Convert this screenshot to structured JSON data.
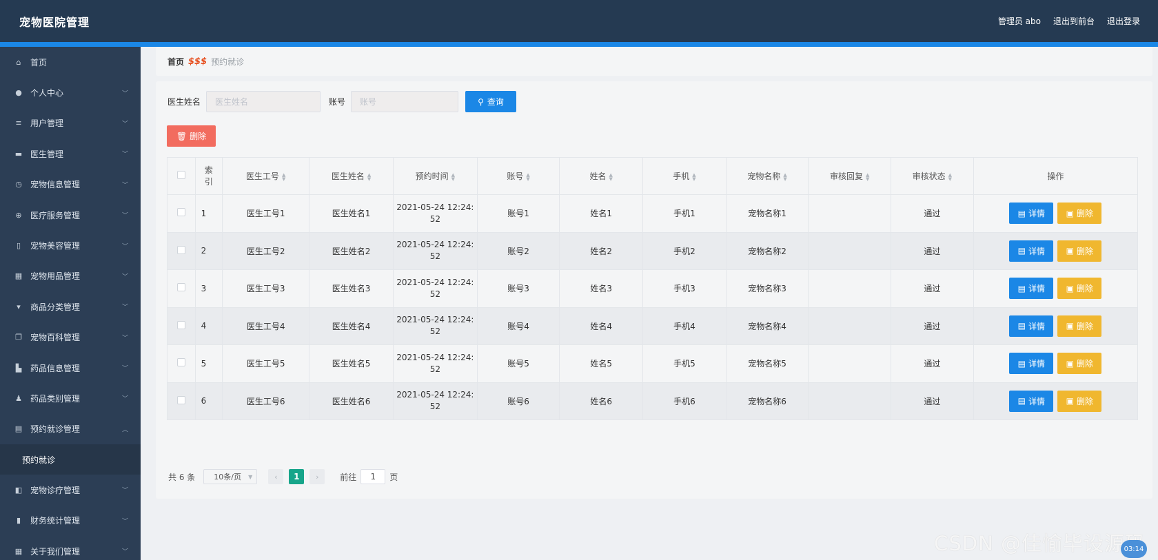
{
  "header": {
    "title": "宠物医院管理",
    "admin_label": "管理员 abo",
    "to_front": "退出到前台",
    "logout": "退出登录"
  },
  "sidebar": {
    "items": [
      {
        "label": "首页",
        "icon": "home-icon",
        "glyph": "⌂",
        "chev": false
      },
      {
        "label": "个人中心",
        "icon": "user-icon",
        "glyph": "●",
        "chev": true
      },
      {
        "label": "用户管理",
        "icon": "list-icon",
        "glyph": "≡",
        "chev": true
      },
      {
        "label": "医生管理",
        "icon": "chat-icon",
        "glyph": "▬",
        "chev": true
      },
      {
        "label": "宠物信息管理",
        "icon": "clock-icon",
        "glyph": "◷",
        "chev": true
      },
      {
        "label": "医疗服务管理",
        "icon": "compass-icon",
        "glyph": "⊕",
        "chev": true
      },
      {
        "label": "宠物美容管理",
        "icon": "mic-icon",
        "glyph": "▯",
        "chev": true
      },
      {
        "label": "宠物用品管理",
        "icon": "grid-icon",
        "glyph": "▦",
        "chev": true
      },
      {
        "label": "商品分类管理",
        "icon": "tag-icon",
        "glyph": "▾",
        "chev": true
      },
      {
        "label": "宠物百科管理",
        "icon": "copy-icon",
        "glyph": "❐",
        "chev": true
      },
      {
        "label": "药品信息管理",
        "icon": "thumb-icon",
        "glyph": "▙",
        "chev": true
      },
      {
        "label": "药品类别管理",
        "icon": "person-icon",
        "glyph": "♟",
        "chev": true
      },
      {
        "label": "预约就诊管理",
        "icon": "folder-icon",
        "glyph": "▤",
        "chev": true,
        "expanded": true
      }
    ],
    "sub_item": "预约就诊",
    "items_after": [
      {
        "label": "宠物诊疗管理",
        "icon": "video-icon",
        "glyph": "◧",
        "chev": true
      },
      {
        "label": "财务统计管理",
        "icon": "bar-chart-icon",
        "glyph": "▮",
        "chev": true
      },
      {
        "label": "关于我们管理",
        "icon": "apps-icon",
        "glyph": "▦",
        "chev": true
      }
    ]
  },
  "breadcrumb": {
    "home": "首页",
    "separator": "$$$",
    "current": "预约就诊"
  },
  "search": {
    "doctor_name_label": "医生姓名",
    "doctor_name_placeholder": "医生姓名",
    "account_label": "账号",
    "account_placeholder": "账号",
    "query_button": "查询"
  },
  "bulk_delete_button": "删除",
  "table": {
    "headers": [
      "索引",
      "医生工号",
      "医生姓名",
      "预约时间",
      "账号",
      "姓名",
      "手机",
      "宠物名称",
      "审核回复",
      "审核状态",
      "操作"
    ],
    "rows": [
      {
        "index": "1",
        "doctor_no": "医生工号1",
        "doctor_name": "医生姓名1",
        "time_a": "2021-05-24 12:24:",
        "time_b": "52",
        "account": "账号1",
        "name": "姓名1",
        "phone": "手机1",
        "pet": "宠物名称1",
        "reply": "",
        "status": "通过"
      },
      {
        "index": "2",
        "doctor_no": "医生工号2",
        "doctor_name": "医生姓名2",
        "time_a": "2021-05-24 12:24:",
        "time_b": "52",
        "account": "账号2",
        "name": "姓名2",
        "phone": "手机2",
        "pet": "宠物名称2",
        "reply": "",
        "status": "通过"
      },
      {
        "index": "3",
        "doctor_no": "医生工号3",
        "doctor_name": "医生姓名3",
        "time_a": "2021-05-24 12:24:",
        "time_b": "52",
        "account": "账号3",
        "name": "姓名3",
        "phone": "手机3",
        "pet": "宠物名称3",
        "reply": "",
        "status": "通过"
      },
      {
        "index": "4",
        "doctor_no": "医生工号4",
        "doctor_name": "医生姓名4",
        "time_a": "2021-05-24 12:24:",
        "time_b": "52",
        "account": "账号4",
        "name": "姓名4",
        "phone": "手机4",
        "pet": "宠物名称4",
        "reply": "",
        "status": "通过"
      },
      {
        "index": "5",
        "doctor_no": "医生工号5",
        "doctor_name": "医生姓名5",
        "time_a": "2021-05-24 12:24:",
        "time_b": "52",
        "account": "账号5",
        "name": "姓名5",
        "phone": "手机5",
        "pet": "宠物名称5",
        "reply": "",
        "status": "通过"
      },
      {
        "index": "6",
        "doctor_no": "医生工号6",
        "doctor_name": "医生姓名6",
        "time_a": "2021-05-24 12:24:",
        "time_b": "52",
        "account": "账号6",
        "name": "姓名6",
        "phone": "手机6",
        "pet": "宠物名称6",
        "reply": "",
        "status": "通过"
      }
    ],
    "detail_button": "详情",
    "delete_button": "删除"
  },
  "pagination": {
    "total": "共 6 条",
    "page_size": "10条/页",
    "current_page": "1",
    "goto_label": "前往",
    "goto_value": "1",
    "page_suffix": "页"
  },
  "overlay": {
    "watermark": "CSDN @佳愉毕设源码",
    "clock": "03:14"
  },
  "colors": {
    "header_bg": "#253a52",
    "sidebar_bg": "#2c3e55",
    "accent": "#1b87e6",
    "danger": "#f26c5f",
    "warning": "#f0b72f",
    "pager_active": "#17a58a"
  }
}
